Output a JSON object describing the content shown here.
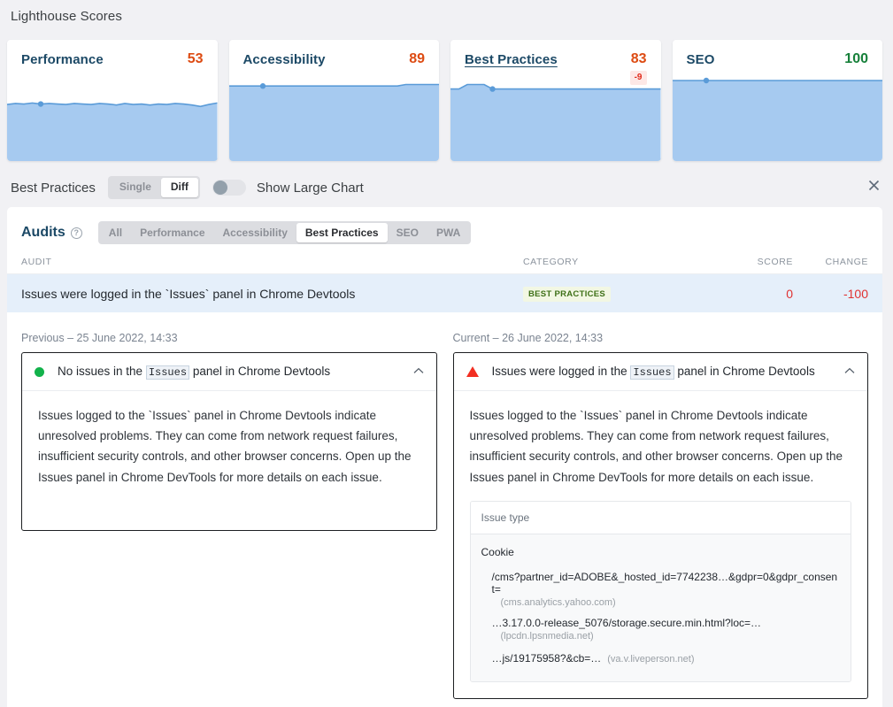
{
  "scores_section": {
    "title": "Lighthouse Scores",
    "cards": [
      {
        "name": "Performance",
        "value": "53",
        "delta": null,
        "selected": false,
        "value_state": "orange"
      },
      {
        "name": "Accessibility",
        "value": "89",
        "delta": null,
        "selected": false,
        "value_state": "orange"
      },
      {
        "name": "Best Practices",
        "value": "83",
        "delta": "-9",
        "selected": true,
        "value_state": "orange"
      },
      {
        "name": "SEO",
        "value": "100",
        "delta": null,
        "selected": false,
        "value_state": "green"
      }
    ]
  },
  "section_bar": {
    "title": "Best Practices",
    "mode_options": [
      "Single",
      "Diff"
    ],
    "mode_selected": "Diff",
    "toggle_label": "Show Large Chart",
    "toggle_on": false,
    "close_icon": "close-icon"
  },
  "audits": {
    "title": "Audits",
    "help_icon": "help-circle-icon",
    "filters": [
      "All",
      "Performance",
      "Accessibility",
      "Best Practices",
      "SEO",
      "PWA"
    ],
    "filter_selected": "Best Practices",
    "columns": [
      "AUDIT",
      "CATEGORY",
      "SCORE",
      "CHANGE"
    ],
    "rows": [
      {
        "audit": "Issues were logged in the `Issues` panel in Chrome Devtools",
        "category": "BEST PRACTICES",
        "score": "0",
        "change": "-100"
      }
    ]
  },
  "diff": {
    "previous": {
      "label": "Previous – 25 June 2022, 14:33",
      "status": "pass",
      "title_before": "No issues in the",
      "title_code": "Issues",
      "title_after": "panel in Chrome Devtools",
      "chevron": "chevron-up-icon",
      "description": "Issues logged to the `Issues` panel in Chrome Devtools indicate unresolved problems. They can come from network request failures, insufficient security controls, and other browser concerns. Open up the Issues panel in Chrome DevTools for more details on each issue."
    },
    "current": {
      "label": "Current – 26 June 2022, 14:33",
      "status": "fail",
      "title_before": "Issues were logged in the",
      "title_code": "Issues",
      "title_after": "panel in Chrome Devtools",
      "chevron": "chevron-up-icon",
      "description": "Issues logged to the `Issues` panel in Chrome Devtools indicate unresolved problems. They can come from network request failures, insufficient security controls, and other browser concerns. Open up the Issues panel in Chrome DevTools for more details on each issue.",
      "detail_table": {
        "header": "Issue type",
        "group": "Cookie",
        "items": [
          {
            "url": "/cms?partner_id=ADOBE&_hosted_id=7742238…&gdpr=0&gdpr_consent=",
            "host": "(cms.analytics.yahoo.com)",
            "host_inline": false
          },
          {
            "url": "…3.17.0.0-release_5076/storage.secure.min.html?loc=…",
            "host": "(lpcdn.lpsnmedia.net)",
            "host_inline": false
          },
          {
            "url": "…js/19175958?&cb=…",
            "host": "(va.v.liveperson.net)",
            "host_inline": true
          }
        ]
      }
    }
  },
  "chart_data": [
    {
      "type": "area",
      "title": "Performance",
      "ylim": [
        0,
        100
      ],
      "values": [
        52,
        54,
        53,
        55,
        53,
        54,
        53,
        52,
        54,
        53,
        52,
        54,
        53,
        51,
        54,
        52,
        53,
        51,
        53,
        52,
        54,
        53,
        51,
        48,
        52,
        55
      ],
      "marker_index": 4,
      "marker_value": 53
    },
    {
      "type": "area",
      "title": "Accessibility",
      "ylim": [
        0,
        100
      ],
      "values": [
        89,
        89,
        89,
        89,
        89,
        89,
        89,
        89,
        89,
        89,
        89,
        89,
        89,
        89,
        89,
        89,
        89,
        89,
        89,
        89,
        89,
        92,
        92,
        92,
        92,
        92
      ],
      "marker_index": 4,
      "marker_value": 89
    },
    {
      "type": "area",
      "title": "Best Practices",
      "ylim": [
        0,
        100
      ],
      "values": [
        83,
        83,
        92,
        92,
        92,
        83,
        83,
        83,
        83,
        83,
        83,
        83,
        83,
        83,
        83,
        83,
        83,
        83,
        83,
        83,
        83,
        83,
        83,
        83,
        83,
        83
      ],
      "marker_index": 5,
      "marker_value": 83
    },
    {
      "type": "area",
      "title": "SEO",
      "ylim": [
        0,
        100
      ],
      "values": [
        100,
        100,
        100,
        100,
        100,
        100,
        100,
        100,
        100,
        100,
        100,
        100,
        100,
        100,
        100,
        100,
        100,
        100,
        100,
        100,
        100,
        100,
        100,
        100,
        100,
        100
      ],
      "marker_index": 4,
      "marker_value": 100
    }
  ],
  "colors": {
    "spark_fill": "#a6caf0",
    "spark_line": "#5a9bd8",
    "score_orange": "#dd4b12",
    "score_green": "#17803a",
    "delta_bg": "#fde8e6",
    "delta_text": "#e02c1c",
    "row_highlight": "#e5effa",
    "badge_bg": "#f2f7e3",
    "badge_text": "#3e7017",
    "negative": "#e03131",
    "pass_dot": "#12b24b",
    "fail_triangle": "#f22f22"
  }
}
